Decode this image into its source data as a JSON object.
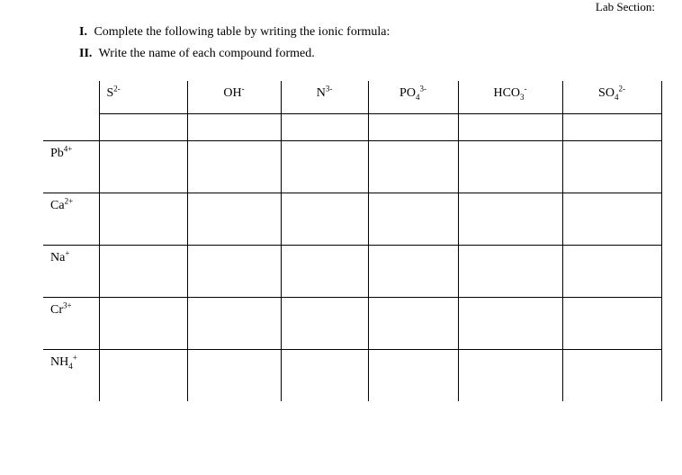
{
  "header": {
    "lab_section": "Lab Section:"
  },
  "instructions": {
    "part1_num": "I.",
    "part1_text": "Complete the following table by writing the ionic formula:",
    "part2_num": "II.",
    "part2_text": "Write the name of each compound formed."
  },
  "ions": {
    "anions": {
      "s": {
        "base": "S",
        "sup": "2-"
      },
      "oh": {
        "base": "OH",
        "sup": "-"
      },
      "n": {
        "base": "N",
        "sup": "3-"
      },
      "po4": {
        "base": "PO",
        "sub": "4",
        "sup": "3-"
      },
      "hco3": {
        "base": "HCO",
        "sub": "3",
        "sup": "-"
      },
      "so4": {
        "base": "SO",
        "sub": "4",
        "sup": "2-"
      }
    },
    "cations": {
      "pb": {
        "base": "Pb",
        "sup": "4+"
      },
      "ca": {
        "base": "Ca",
        "sup": "2+"
      },
      "na": {
        "base": "Na",
        "sup": "+"
      },
      "cr": {
        "base": "Cr",
        "sup": "3+"
      },
      "nh4": {
        "base": "NH",
        "sub": "4",
        "sup": "+"
      }
    }
  }
}
